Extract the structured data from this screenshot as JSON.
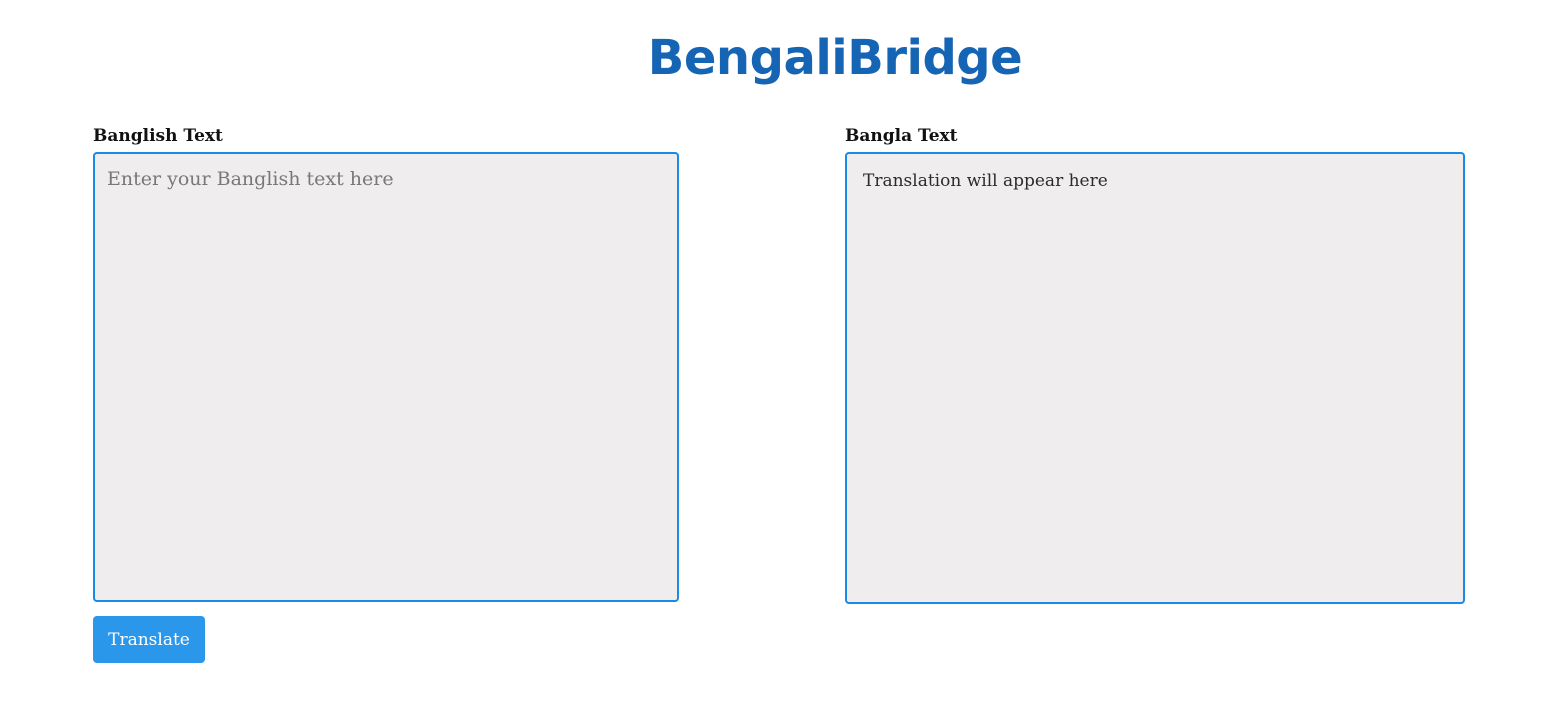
{
  "app": {
    "title": "BengaliBridge",
    "accent_color": "#1565b4",
    "border_color": "#1a8ae6",
    "button_color": "#2b97ea",
    "box_background": "#efedee"
  },
  "input_panel": {
    "label": "Banglish Text",
    "value": "",
    "placeholder": "Enter your Banglish text here"
  },
  "output_panel": {
    "label": "Bangla Text",
    "text": "Translation will appear here"
  },
  "actions": {
    "translate_label": "Translate"
  }
}
